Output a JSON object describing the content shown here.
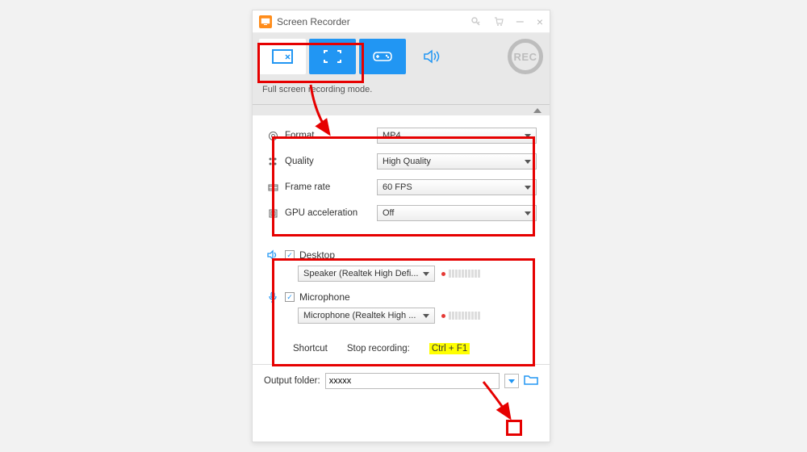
{
  "window": {
    "title": "Screen Recorder"
  },
  "toolbar": {
    "mode_text": "Full screen recording mode.",
    "rec_label": "REC"
  },
  "settings": {
    "format": {
      "label": "Format",
      "value": "MP4"
    },
    "quality": {
      "label": "Quality",
      "value": "High Quality"
    },
    "frame_rate": {
      "label": "Frame rate",
      "value": "60 FPS"
    },
    "gpu": {
      "label": "GPU acceleration",
      "value": "Off"
    }
  },
  "audio": {
    "desktop": {
      "label": "Desktop",
      "checked": true,
      "device": "Speaker (Realtek High Defi..."
    },
    "microphone": {
      "label": "Microphone",
      "checked": true,
      "device": "Microphone (Realtek High ..."
    }
  },
  "shortcut": {
    "label": "Shortcut",
    "stop_label": "Stop recording:",
    "hotkey": "Ctrl + F1"
  },
  "output": {
    "label": "Output folder:",
    "value": "xxxxx"
  }
}
